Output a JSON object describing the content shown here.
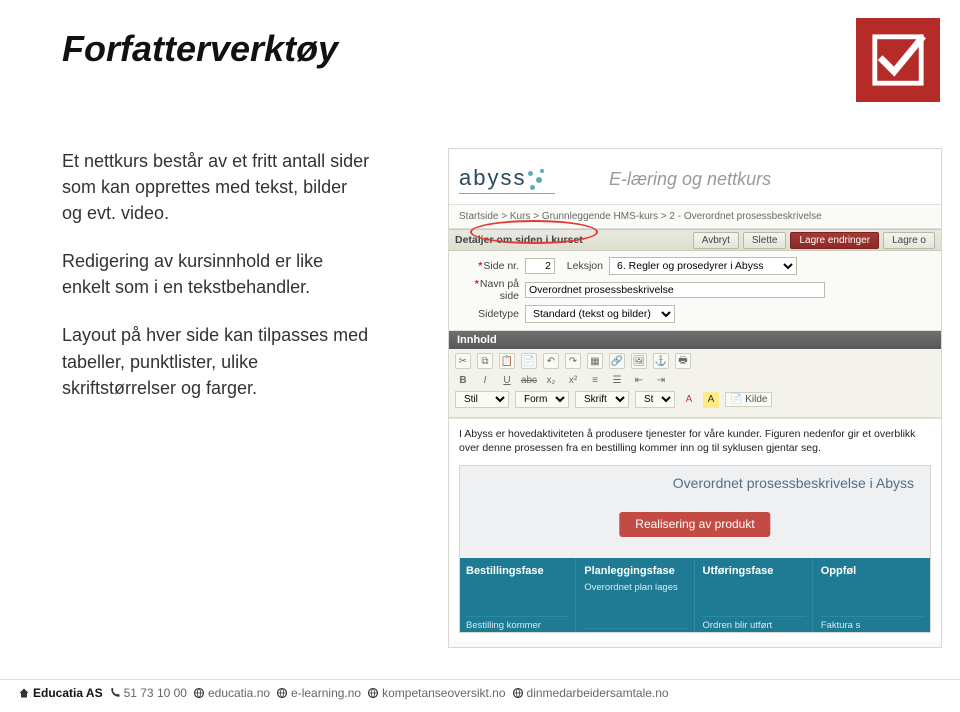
{
  "title": "Forfatterverktøy",
  "paragraphs": {
    "p1": "Et nettkurs består av et fritt antall sider som kan opprettes med tekst, bilder og evt. video.",
    "p2": "Redigering av kursinnhold er like enkelt som i en tekstbehandler.",
    "p3": "Layout på hver side kan tilpasses med tabeller, punktlister, ulike skriftstørrelser og farger."
  },
  "shot": {
    "logo_text": "abyss",
    "tagline": "E-læring og nettkurs",
    "breadcrumb": "Startside  >  Kurs  >  Grunnleggende HMS-kurs  >  2 - Overordnet prosessbeskrivelse",
    "detail_title": "Detaljer om siden i kurset",
    "buttons": {
      "avbryt": "Avbryt",
      "slette": "Slette",
      "lagre": "Lagre endringer",
      "lagre_o": "Lagre o"
    },
    "form": {
      "side_nr_label": "Side nr.",
      "side_nr_value": "2",
      "leksjon_label": "Leksjon",
      "leksjon_value": "6. Regler og prosedyrer i Abyss",
      "navn_label": "Navn på side",
      "navn_value": "Overordnet prosessbeskrivelse",
      "sidetype_label": "Sidetype",
      "sidetype_value": "Standard (tekst og bilder)"
    },
    "innhold_label": "Innhold",
    "toolbar": {
      "stil": "Stil",
      "format": "Format",
      "skrift": "Skrift",
      "st": "St...",
      "kilde": "Kilde"
    },
    "editor_text": "I Abyss er hovedaktiviteten å produsere tjenester for våre kunder. Figuren nedenfor gir et overblikk over denne prosessen fra en bestilling kommer inn og til syklusen gjentar seg.",
    "diagram": {
      "title": "Overordnet prosessbeskrivelse i Abyss",
      "band": "Realisering av produkt",
      "cols": [
        {
          "h": "Bestillingsfase",
          "s": "",
          "f": "Bestilling kommer"
        },
        {
          "h": "Planleggingsfase",
          "s": "Overordnet plan lages",
          "f": ""
        },
        {
          "h": "Utføringsfase",
          "s": "",
          "f": "Ordren blir utført"
        },
        {
          "h": "Oppføl",
          "s": "",
          "f": "Faktura s"
        }
      ]
    }
  },
  "footer": {
    "company": "Educatia AS",
    "phone": "51 73 10 00",
    "links": [
      "educatia.no",
      "e-learning.no",
      "kompetanseoversikt.no",
      "dinmedarbeidersamtale.no"
    ]
  }
}
